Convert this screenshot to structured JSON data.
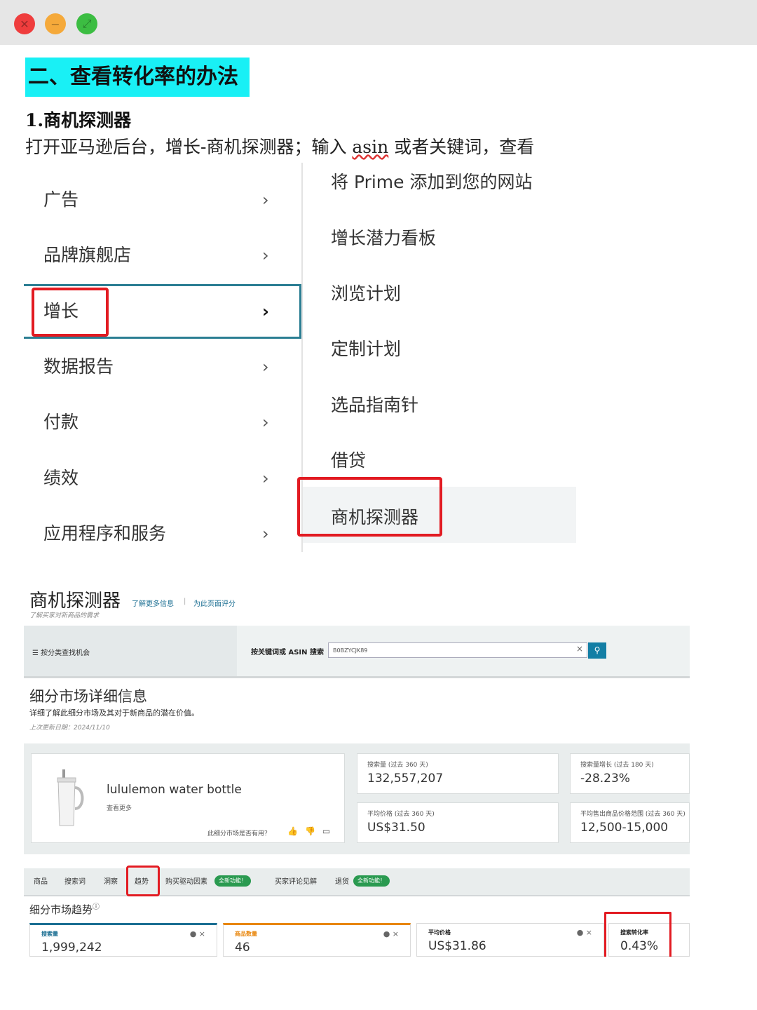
{
  "window": {
    "controls": [
      "close",
      "minimize",
      "maximize"
    ]
  },
  "doc": {
    "section_heading": "二、查看转化率的办法",
    "sub_heading": "1.商机探测器",
    "paragraph_before": "打开亚马逊后台，增长-商机探测器；输入 ",
    "paragraph_word": "asin",
    "paragraph_after": " 或者关键词，查看"
  },
  "menu": {
    "items": [
      {
        "label": "广告"
      },
      {
        "label": "品牌旗舰店"
      },
      {
        "label": "增长"
      },
      {
        "label": "数据报告"
      },
      {
        "label": "付款"
      },
      {
        "label": "绩效"
      },
      {
        "label": "应用程序和服务"
      }
    ],
    "chevron": "›",
    "submenu": [
      {
        "label": "将 Prime 添加到您的网站"
      },
      {
        "label": "增长潜力看板"
      },
      {
        "label": "浏览计划"
      },
      {
        "label": "定制计划"
      },
      {
        "label": "选品指南针"
      },
      {
        "label": "借贷"
      },
      {
        "label": "商机探测器"
      }
    ]
  },
  "explorer": {
    "title": "商机探测器",
    "link_learn": "了解更多信息",
    "separator": "|",
    "link_rate": "为此页面评分",
    "subtitle": "了解买家对新商品的需求",
    "search_category_label": "按分类查找机会",
    "search_label": "按关键词或 ASIN 搜索",
    "search_value": "B0BZYCJK89",
    "clear": "×",
    "search_button_icon": "⚲",
    "segment_title": "细分市场详细信息",
    "segment_desc": "详细了解此细分市场及其对于新商品的潜在价值。",
    "segment_date": "上次更新日期：2024/11/10",
    "product_name": "lululemon water bottle",
    "product_sub": "查看更多",
    "product_question": "此细分市场是否有用？",
    "stats": [
      {
        "label": "搜索量 (过去 360 天)",
        "value": "132,557,207"
      },
      {
        "label": "搜索量增长 (过去 180 天)",
        "value": "-28.23%"
      },
      {
        "label": "平均价格 (过去 360 天)",
        "value": "US$31.50"
      },
      {
        "label": "平均售出商品价格范围 (过去 360 天)",
        "value": "12,500-15,000"
      }
    ],
    "tabs": [
      "商品",
      "搜索词",
      "洞察",
      "趋势",
      "购买驱动因素",
      "买家评论见解",
      "退货"
    ],
    "pill": "全新功能！",
    "trend_title": "细分市场趋势",
    "metrics": [
      {
        "label": "搜索量",
        "value": "1,999,242",
        "color": "#1a6e92"
      },
      {
        "label": "商品数量",
        "value": "46",
        "color": "#e8860c"
      },
      {
        "label": "平均价格",
        "value": "US$31.86",
        "color": "#333333"
      },
      {
        "label": "搜索转化率",
        "value": "0.43%",
        "color": "#333333"
      }
    ]
  },
  "colors": {
    "highlight": "#19f0f5",
    "annotation": "#e21b22",
    "accent": "#2b7e93"
  }
}
